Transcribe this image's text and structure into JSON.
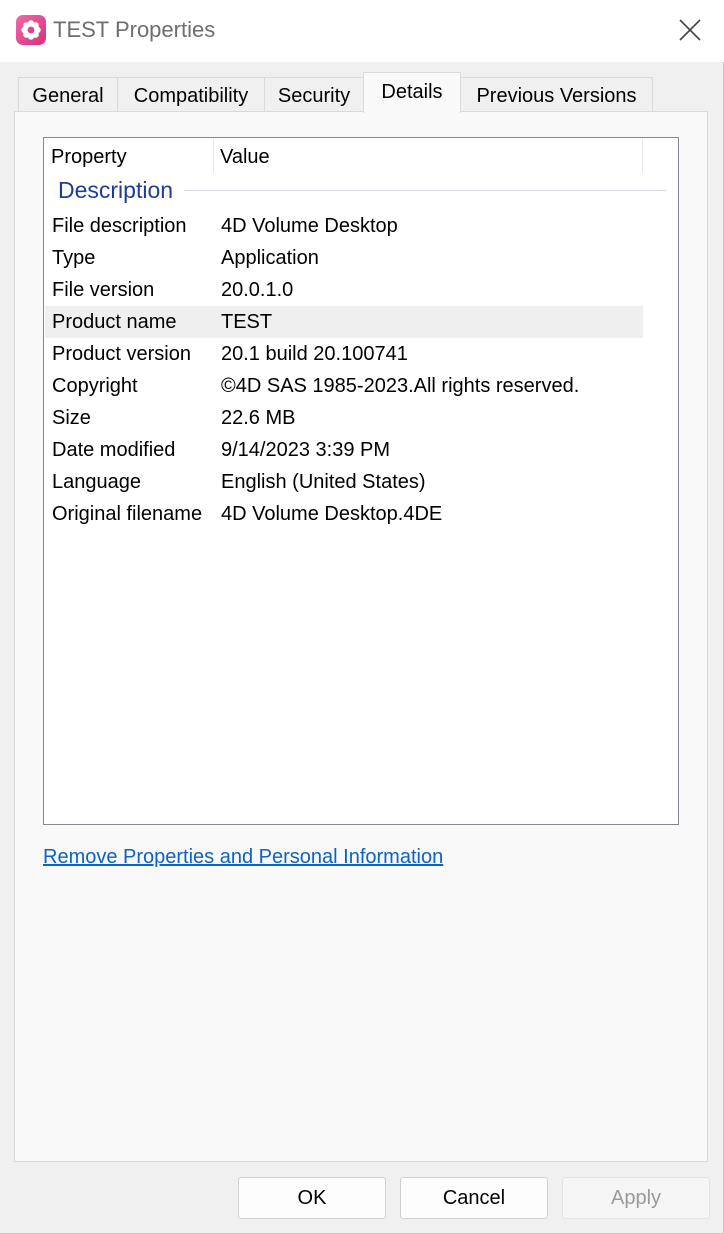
{
  "window": {
    "title": "TEST Properties",
    "app_icon": "gear-flower-icon",
    "close_icon": "close-icon"
  },
  "tabs": [
    {
      "label": "General",
      "active": false
    },
    {
      "label": "Compatibility",
      "active": false
    },
    {
      "label": "Security",
      "active": false
    },
    {
      "label": "Details",
      "active": true
    },
    {
      "label": "Previous Versions",
      "active": false
    }
  ],
  "details": {
    "columns": {
      "property": "Property",
      "value": "Value"
    },
    "group_label": "Description",
    "rows": [
      {
        "property": "File description",
        "value": "4D Volume Desktop"
      },
      {
        "property": "Type",
        "value": "Application"
      },
      {
        "property": "File version",
        "value": "20.0.1.0"
      },
      {
        "property": "Product name",
        "value": "TEST"
      },
      {
        "property": "Product version",
        "value": "20.1 build 20.100741"
      },
      {
        "property": "Copyright",
        "value": "©4D SAS 1985-2023.All rights reserved."
      },
      {
        "property": "Size",
        "value": "22.6 MB"
      },
      {
        "property": "Date modified",
        "value": "9/14/2023 3:39 PM"
      },
      {
        "property": "Language",
        "value": "English (United States)"
      },
      {
        "property": "Original filename",
        "value": "4D Volume Desktop.4DE"
      }
    ],
    "selected_row": "Product name"
  },
  "link": {
    "label": "Remove Properties and Personal Information"
  },
  "buttons": {
    "ok": "OK",
    "cancel": "Cancel",
    "apply": "Apply"
  },
  "colors": {
    "link": "#0b63c4",
    "group_label": "#1e3d9b",
    "app_icon": "#e0438f"
  }
}
